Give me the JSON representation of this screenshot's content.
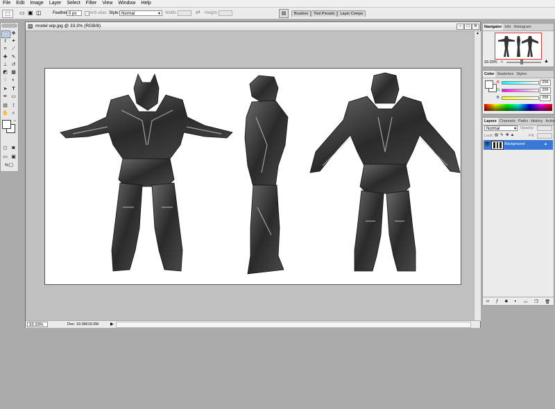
{
  "menu": [
    "File",
    "Edit",
    "Image",
    "Layer",
    "Select",
    "Filter",
    "View",
    "Window",
    "Help"
  ],
  "options": {
    "feather_label": "Feather:",
    "feather_value": "0 px",
    "antialias_label": "Anti-alias",
    "style_label": "Style:",
    "style_value": "Normal",
    "width_label": "Width:",
    "height_label": "Height:",
    "tabs": [
      "Brushes",
      "Tool Presets",
      "Layer Comps"
    ]
  },
  "document": {
    "title": "model wip.jpg @ 33.3% (RGB/8)",
    "zoom": "33.33%",
    "doc_info": "Doc: 19.3M/19.3M"
  },
  "navigator": {
    "tabs": [
      "Navigator",
      "Info",
      "Histogram"
    ],
    "zoom": "33.33%"
  },
  "color": {
    "tabs": [
      "Color",
      "Swatches",
      "Styles"
    ],
    "channels": [
      {
        "label": "R",
        "value": "255",
        "color": "#e04040"
      },
      {
        "label": "G",
        "value": "255",
        "color": "#40c040"
      },
      {
        "label": "B",
        "value": "255",
        "color": "#4060e0"
      }
    ]
  },
  "layers": {
    "tabs": [
      "Layers",
      "Channels",
      "Paths",
      "History",
      "Actions"
    ],
    "blend_mode": "Normal",
    "opacity_label": "Opacity:",
    "lock_label": "Lock:",
    "fill_label": "Fill:",
    "layer_name": "Background"
  },
  "colors": {
    "accent": "#3a78d6",
    "canvas_bg": "#ffffff",
    "workspace": "#ababab"
  }
}
